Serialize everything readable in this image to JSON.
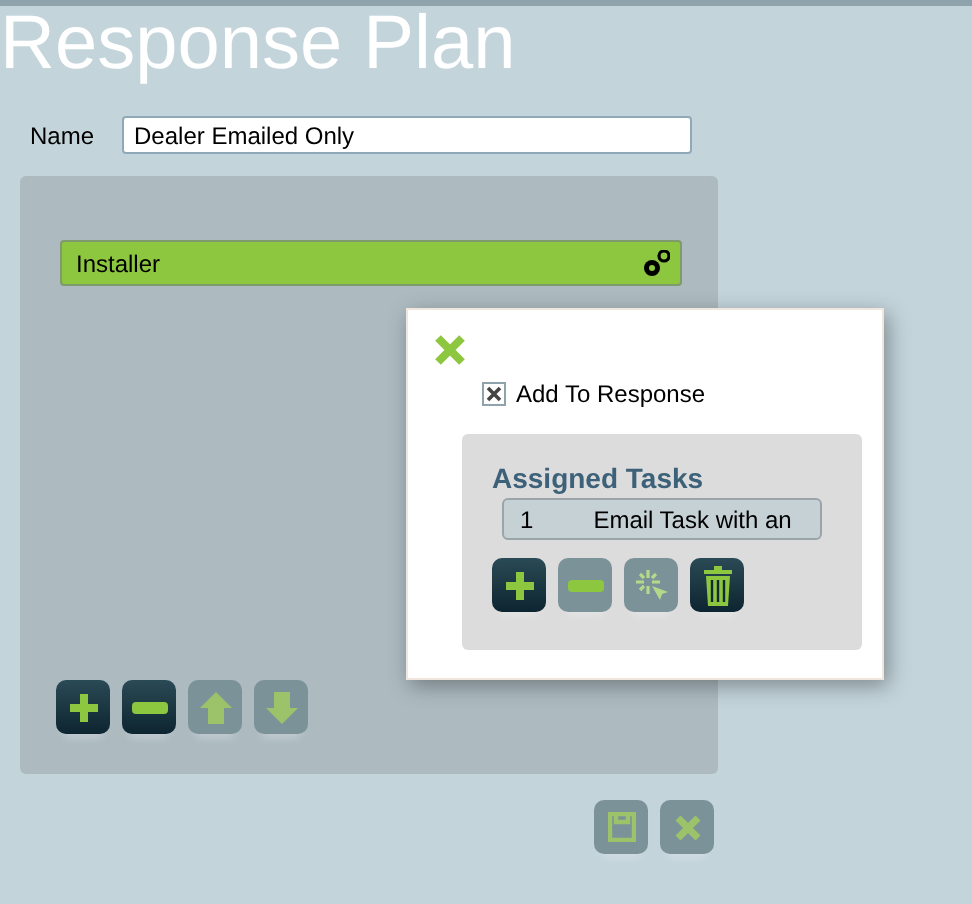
{
  "title": "Response Plan",
  "name_field": {
    "label": "Name",
    "value": "Dealer Emailed Only"
  },
  "contacts": [
    {
      "label": "Installer",
      "selected": true
    }
  ],
  "list_buttons": [
    {
      "kind": "add",
      "disabled": false
    },
    {
      "kind": "remove",
      "disabled": false
    },
    {
      "kind": "up",
      "disabled": true
    },
    {
      "kind": "down",
      "disabled": true
    }
  ],
  "popup": {
    "checkbox": {
      "label": "Add To Response",
      "checked": true
    },
    "tasks_title": "Assigned Tasks",
    "tasks": [
      {
        "number": "1",
        "name": "Email Task with an"
      }
    ],
    "task_buttons": [
      {
        "kind": "add",
        "disabled": false
      },
      {
        "kind": "remove",
        "disabled": true
      },
      {
        "kind": "wizard",
        "disabled": true
      },
      {
        "kind": "trash",
        "disabled": false
      }
    ]
  },
  "footer_buttons": [
    {
      "kind": "save",
      "disabled": true
    },
    {
      "kind": "cancel",
      "disabled": true
    }
  ]
}
